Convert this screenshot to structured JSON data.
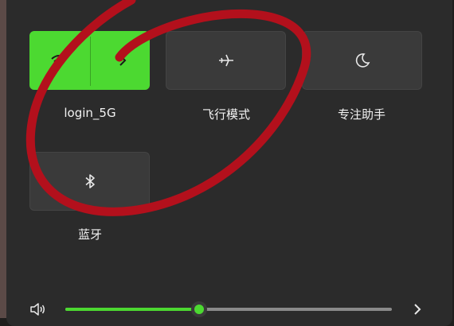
{
  "tiles": {
    "wifi": {
      "label": "login_5G",
      "active": true
    },
    "airplane": {
      "label": "飞行模式",
      "active": false
    },
    "focus": {
      "label": "专注助手",
      "active": false
    },
    "bluetooth": {
      "label": "蓝牙",
      "active": false
    }
  },
  "volume": {
    "level": 0.41
  },
  "colors": {
    "accent": "#4cd931",
    "panel": "#2b2b2b",
    "tile": "#3a3a3a",
    "annotation": "#b3101c"
  },
  "icons": [
    "wifi-icon",
    "chevron-right-icon",
    "airplane-icon",
    "moon-icon",
    "bluetooth-icon",
    "speaker-icon"
  ]
}
